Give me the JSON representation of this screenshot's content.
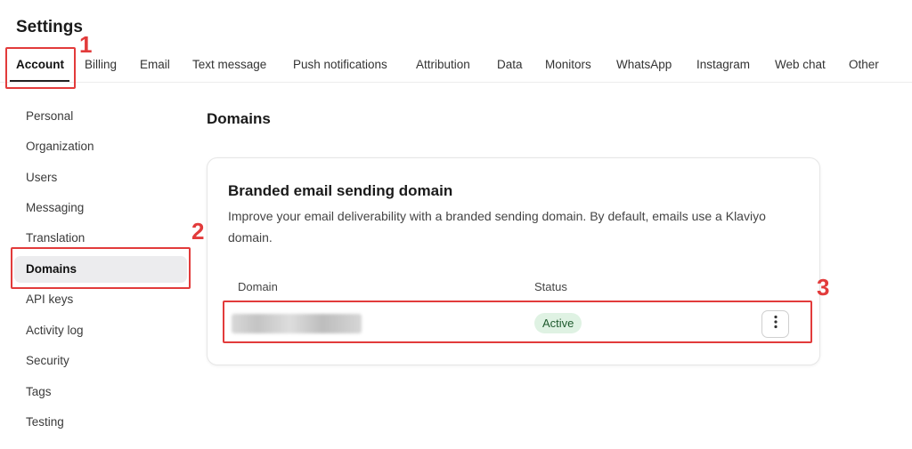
{
  "page": {
    "title": "Settings"
  },
  "tabs": [
    {
      "label": "Account",
      "active": true
    },
    {
      "label": "Billing"
    },
    {
      "label": "Email"
    },
    {
      "label": "Text message"
    },
    {
      "label": "Push notifications"
    },
    {
      "label": "Attribution"
    },
    {
      "label": "Data"
    },
    {
      "label": "Monitors"
    },
    {
      "label": "WhatsApp"
    },
    {
      "label": "Instagram"
    },
    {
      "label": "Web chat"
    },
    {
      "label": "Other"
    }
  ],
  "sidebar": {
    "items": [
      {
        "label": "Personal"
      },
      {
        "label": "Organization"
      },
      {
        "label": "Users"
      },
      {
        "label": "Messaging"
      },
      {
        "label": "Translation"
      },
      {
        "label": "Domains",
        "active": true
      },
      {
        "label": "API keys"
      },
      {
        "label": "Activity log"
      },
      {
        "label": "Security"
      },
      {
        "label": "Tags"
      },
      {
        "label": "Testing"
      }
    ]
  },
  "main": {
    "section_title": "Domains",
    "card": {
      "title": "Branded email sending domain",
      "description": "Improve your email deliverability with a branded sending domain. By default, emails use a Klaviyo domain.",
      "columns": {
        "domain": "Domain",
        "status": "Status"
      },
      "rows": [
        {
          "status": "Active",
          "actions_icon": "more-vertical-icon"
        }
      ]
    }
  },
  "annotations": [
    "1",
    "2",
    "3"
  ],
  "colors": {
    "annotation": "#e23b3b",
    "badge_bg": "#dff2e3",
    "badge_text": "#1f5a2e",
    "active_sidebar_bg": "#ececee"
  }
}
